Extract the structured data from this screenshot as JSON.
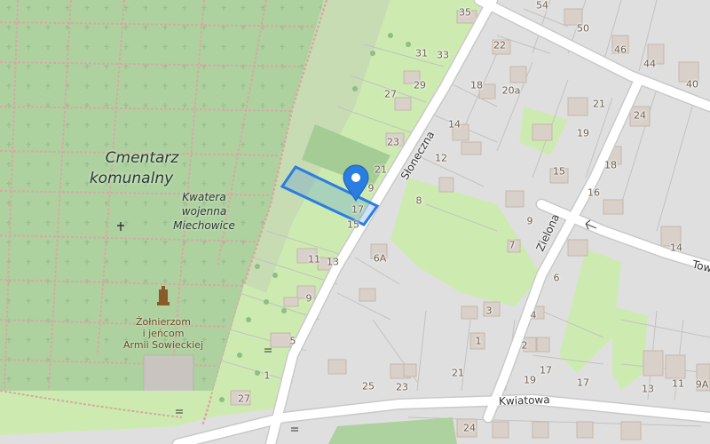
{
  "cemetery": {
    "name_line1": "Cmentarz",
    "name_line2": "komunalny",
    "section_line1": "Kwatera",
    "section_line2": "wojenna",
    "section_line3": "Miechowice",
    "memorial_line1": "Żołnierzom",
    "memorial_line2": "i jeńcom",
    "memorial_line3": "Armii Sowieckiej"
  },
  "streets": {
    "sloneczna": "Słoneczna",
    "zielona": "Zielona",
    "kwiatowa": "Kwiatowa",
    "tow": "Tow"
  },
  "house_numbers": [
    "35",
    "54",
    "50",
    "46",
    "44",
    "40",
    "31",
    "33",
    "22",
    "18",
    "20a",
    "27",
    "29",
    "21",
    "24",
    "23",
    "14",
    "19",
    "12",
    "18",
    "15",
    "21",
    "9",
    "8",
    "16",
    "17",
    "15",
    "9",
    "7",
    "14",
    "13",
    "11",
    "13",
    "6A",
    "6",
    "9",
    "3",
    "4",
    "5",
    "1",
    "2",
    "1",
    "21",
    "17",
    "25",
    "23",
    "19",
    "17",
    "13",
    "11",
    "9A",
    "24",
    "27"
  ],
  "marker": {
    "icon": "location-pin-icon",
    "color": "#2a7de1"
  },
  "colors": {
    "cemetery": "#aed1a0",
    "grass": "#cdebb0",
    "residential": "#e0dfdf",
    "road": "#ffffff",
    "building": "#d9d0c9",
    "highlight": "#2a7de1"
  }
}
